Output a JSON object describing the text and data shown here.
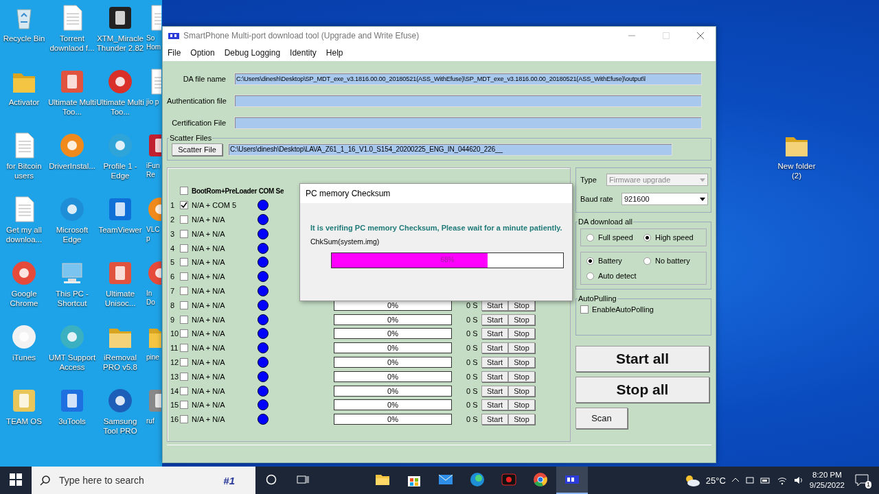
{
  "desktop": {
    "icons": [
      {
        "label": "Recycle Bin",
        "kind": "bin",
        "color": "#d8e8f0"
      },
      {
        "label": "Torrent downlaod f...",
        "kind": "doc",
        "color": "#ffffff"
      },
      {
        "label": "XTM_Miracle Thunder 2.82",
        "kind": "app",
        "color": "#222222"
      },
      {
        "label": "Activator",
        "kind": "folder",
        "color": "#f4c542"
      },
      {
        "label": "Ultimate Multi Too...",
        "kind": "app",
        "color": "#e0533f"
      },
      {
        "label": "Ultimate Multi Too...",
        "kind": "round",
        "color": "#d9302a"
      },
      {
        "label": "for Bitcoin users",
        "kind": "doc",
        "color": "#ffffff"
      },
      {
        "label": "DriverInstal...",
        "kind": "round",
        "color": "#f08a1c"
      },
      {
        "label": "Profile 1 - Edge",
        "kind": "round",
        "color": "#2fa4d8"
      },
      {
        "label": "Get my all downloa...",
        "kind": "doc",
        "color": "#ffffff"
      },
      {
        "label": "Microsoft Edge",
        "kind": "round",
        "color": "#1e8fd6"
      },
      {
        "label": "TeamViewer",
        "kind": "app",
        "color": "#1170d8"
      },
      {
        "label": "Google Chrome",
        "kind": "round",
        "color": "#e64a3b"
      },
      {
        "label": "This PC - Shortcut",
        "kind": "pc",
        "color": "#7cc4f0"
      },
      {
        "label": "Ultimate Unisoc...",
        "kind": "app",
        "color": "#e0533f"
      },
      {
        "label": "iTunes",
        "kind": "round",
        "color": "#f2f2f2"
      },
      {
        "label": "UMT Support Access",
        "kind": "round",
        "color": "#3ab0c0"
      },
      {
        "label": "iRemoval PRO v5.8",
        "kind": "folder",
        "color": "#f4d27a"
      },
      {
        "label": "TEAM OS",
        "kind": "app",
        "color": "#e8c65a"
      },
      {
        "label": "3uTools",
        "kind": "app",
        "color": "#1e6fe0"
      },
      {
        "label": "Samsung Tool PRO",
        "kind": "round",
        "color": "#1d5fb8"
      }
    ],
    "cut_icons": [
      {
        "label": "So Hom",
        "kind": "doc",
        "color": "#ffffff"
      },
      {
        "label": "jio p",
        "kind": "doc",
        "color": "#ffffff"
      },
      {
        "label": "iFun Re",
        "kind": "app",
        "color": "#c02030"
      },
      {
        "label": "VLC p",
        "kind": "round",
        "color": "#f08a1c"
      },
      {
        "label": "In Do",
        "kind": "round",
        "color": "#e64a3b"
      },
      {
        "label": "pine",
        "kind": "folder",
        "color": "#f4c542"
      },
      {
        "label": "ruf",
        "kind": "app",
        "color": "#888888"
      }
    ],
    "right_icons": [
      {
        "label": "New folder (2)",
        "kind": "folder",
        "color": "#f4d27a"
      }
    ]
  },
  "window": {
    "title": "SmartPhone Multi-port download tool (Upgrade and Write Efuse)",
    "menu": [
      "File",
      "Option",
      "Debug Logging",
      "Identity",
      "Help"
    ],
    "fields": [
      {
        "label": "DA file name",
        "value": "C:\\Users\\dinesh\\Desktop\\SP_MDT_exe_v3.1816.00.00_20180521(ASS_WithEfuse)\\SP_MDT_exe_v3.1816.00.00_20180521(ASS_WithEfuse)\\output\\l"
      },
      {
        "label": "Authentication file"
      },
      {
        "label": "Certification File"
      }
    ],
    "scatter": {
      "group_label": "Scatter Files",
      "button": "Scatter File",
      "value": "C:\\Users\\dinesh\\Desktop\\LAVA_Z61_1_16_V1.0_S154_20200225_ENG_IN_044620_226__"
    },
    "ports": {
      "header": {
        "label": "BootRom+PreLoader COM Se",
        "checked": false
      },
      "rows": [
        {
          "index": "1",
          "checked": true,
          "port": "N/A + COM 5"
        },
        {
          "index": "2",
          "checked": false,
          "port": "N/A + N/A"
        },
        {
          "index": "3",
          "checked": false,
          "port": "N/A + N/A"
        },
        {
          "index": "4",
          "checked": false,
          "port": "N/A + N/A"
        },
        {
          "index": "5",
          "checked": false,
          "port": "N/A + N/A"
        },
        {
          "index": "6",
          "checked": false,
          "port": "N/A + N/A"
        },
        {
          "index": "7",
          "checked": false,
          "port": "N/A + N/A"
        },
        {
          "index": "8",
          "checked": false,
          "port": "N/A + N/A",
          "level": 0,
          "progress": "0%",
          "time": "0 S",
          "start": "Start",
          "stop": "Stop"
        },
        {
          "index": "9",
          "checked": false,
          "port": "N/A + N/A",
          "level": 0,
          "progress": "0%",
          "time": "0 S",
          "start": "Start",
          "stop": "Stop"
        },
        {
          "index": "10",
          "checked": false,
          "port": "N/A + N/A",
          "level": 0,
          "progress": "0%",
          "time": "0 S",
          "start": "Start",
          "stop": "Stop"
        },
        {
          "index": "11",
          "checked": false,
          "port": "N/A + N/A",
          "level": 0,
          "progress": "0%",
          "time": "0 S",
          "start": "Start",
          "stop": "Stop"
        },
        {
          "index": "12",
          "checked": false,
          "port": "N/A + N/A",
          "level": 0,
          "progress": "0%",
          "time": "0 S",
          "start": "Start",
          "stop": "Stop"
        },
        {
          "index": "13",
          "checked": false,
          "port": "N/A + N/A",
          "level": 0,
          "progress": "0%",
          "time": "0 S",
          "start": "Start",
          "stop": "Stop"
        },
        {
          "index": "14",
          "checked": false,
          "port": "N/A + N/A",
          "level": 0,
          "progress": "0%",
          "time": "0 S",
          "start": "Start",
          "stop": "Stop"
        },
        {
          "index": "15",
          "checked": false,
          "port": "N/A + N/A",
          "level": 0,
          "progress": "0%",
          "time": "0 S",
          "start": "Start",
          "stop": "Stop"
        },
        {
          "index": "16",
          "checked": false,
          "port": "N/A + N/A",
          "level": 0,
          "progress": "0%",
          "time": "0 S",
          "start": "Start",
          "stop": "Stop"
        }
      ]
    },
    "dialog": {
      "title": "PC memory Checksum",
      "message": "It is verifing PC memory Checksum, Please wait for a minute  patiently.",
      "file": "ChkSum(system.img)",
      "level": 0.675,
      "percent": "68%"
    },
    "settings": {
      "type": {
        "label": "Type",
        "value": "Firmware upgrade",
        "disabled": true
      },
      "baud": {
        "label": "Baud rate",
        "value": "921600",
        "disabled": false
      },
      "da_group": {
        "label": "DA download all",
        "speed": [
          {
            "label": "Full speed",
            "selected": false
          },
          {
            "label": "High speed",
            "selected": true
          }
        ],
        "power": [
          {
            "label": "Battery",
            "selected": true
          },
          {
            "label": "No battery",
            "selected": false
          },
          {
            "label": "Auto detect",
            "selected": false
          }
        ]
      },
      "autopolling": {
        "label": "AutoPulling",
        "option": "EnableAutoPolling",
        "checked": false
      },
      "start_all": "Start all",
      "stop_all": "Stop all",
      "scan": "Scan"
    }
  },
  "taskbar": {
    "search_placeholder": "Type here to search",
    "search_badge": "#1",
    "apps": [
      {
        "kind": "explorer",
        "active": false
      },
      {
        "kind": "store",
        "active": false
      },
      {
        "kind": "mail",
        "active": false
      },
      {
        "kind": "edge",
        "active": false
      },
      {
        "kind": "recorder",
        "active": false
      },
      {
        "kind": "chrome",
        "active": false
      },
      {
        "kind": "tool",
        "active": true
      }
    ],
    "weather": "25°C",
    "time": "8:20 PM",
    "date": "9/25/2022",
    "notification_count": "1"
  }
}
